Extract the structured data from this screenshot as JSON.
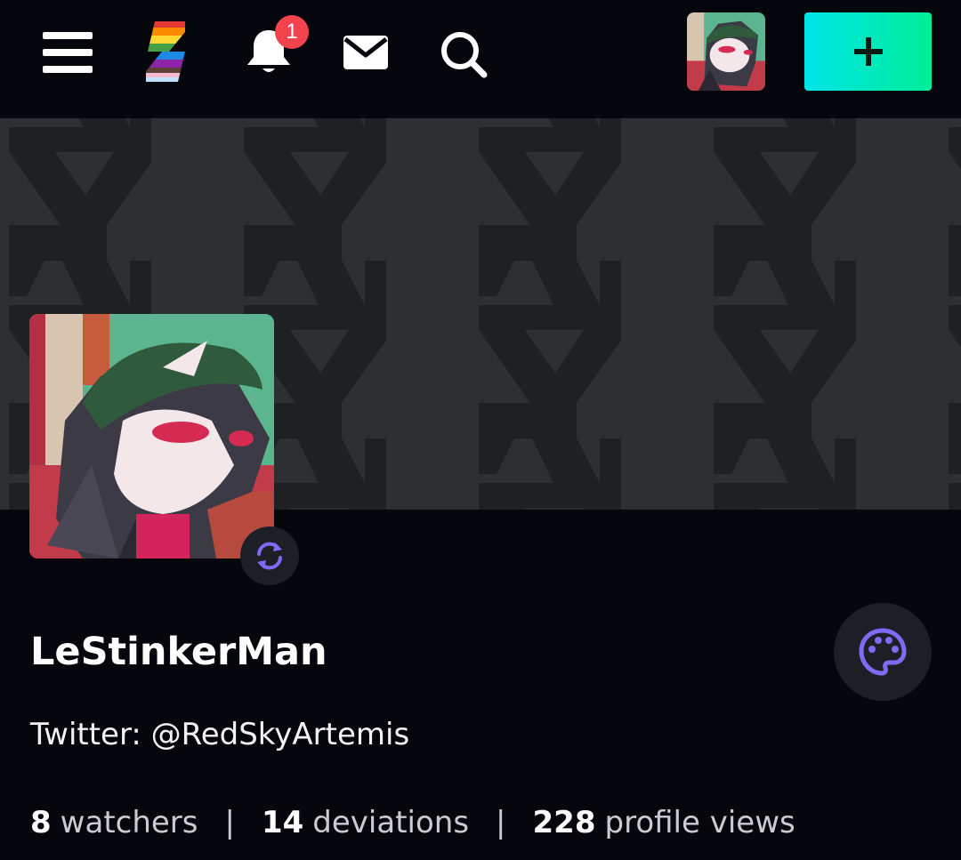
{
  "header": {
    "menu_icon": "hamburger-menu-icon",
    "logo_icon": "deviantart-pride-logo",
    "notifications": {
      "icon": "bell-icon",
      "badge_count": "1",
      "badge_color": "#f2434f"
    },
    "messages_icon": "envelope-icon",
    "search_icon": "search-icon",
    "create_icon": "plus-icon",
    "create_button_colors": [
      "#00e4e8",
      "#00ee97"
    ]
  },
  "profile": {
    "username": "LeStinkerMan",
    "tagline": "Twitter: @RedSkyArtemis",
    "avatar_edit_icon": "refresh-icon",
    "theme_icon": "palette-icon",
    "accent_color": "#7c6cf5",
    "stats": [
      {
        "value": "8",
        "label": "watchers"
      },
      {
        "value": "14",
        "label": "deviations"
      },
      {
        "value": "228",
        "label": "profile views"
      }
    ],
    "separator": "|"
  },
  "colors": {
    "page_background": "#06070d",
    "banner_background": "#2e2f32",
    "banner_pattern": "#1f2023"
  }
}
